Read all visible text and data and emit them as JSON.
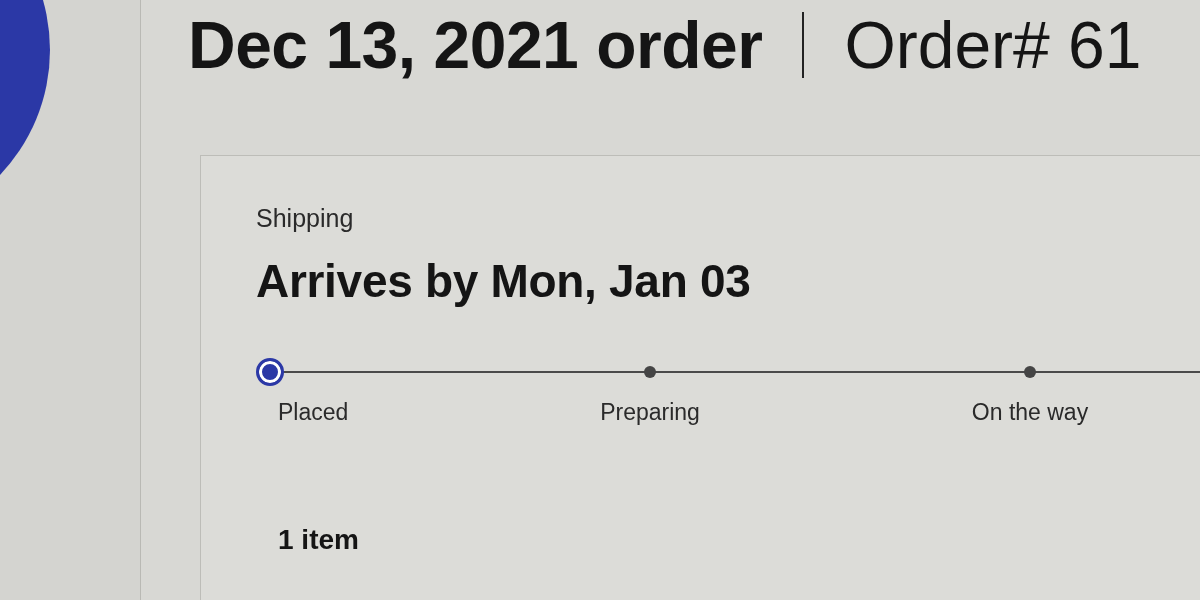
{
  "header": {
    "title": "Dec 13, 2021 order",
    "order_number": "Order# 61"
  },
  "shipping": {
    "label": "Shipping",
    "arrival": "Arrives by Mon, Jan 03",
    "tracker": {
      "steps": [
        {
          "label": "Placed",
          "current": true
        },
        {
          "label": "Preparing",
          "current": false
        },
        {
          "label": "On the way",
          "current": false
        }
      ]
    },
    "items_count": "1 item"
  }
}
